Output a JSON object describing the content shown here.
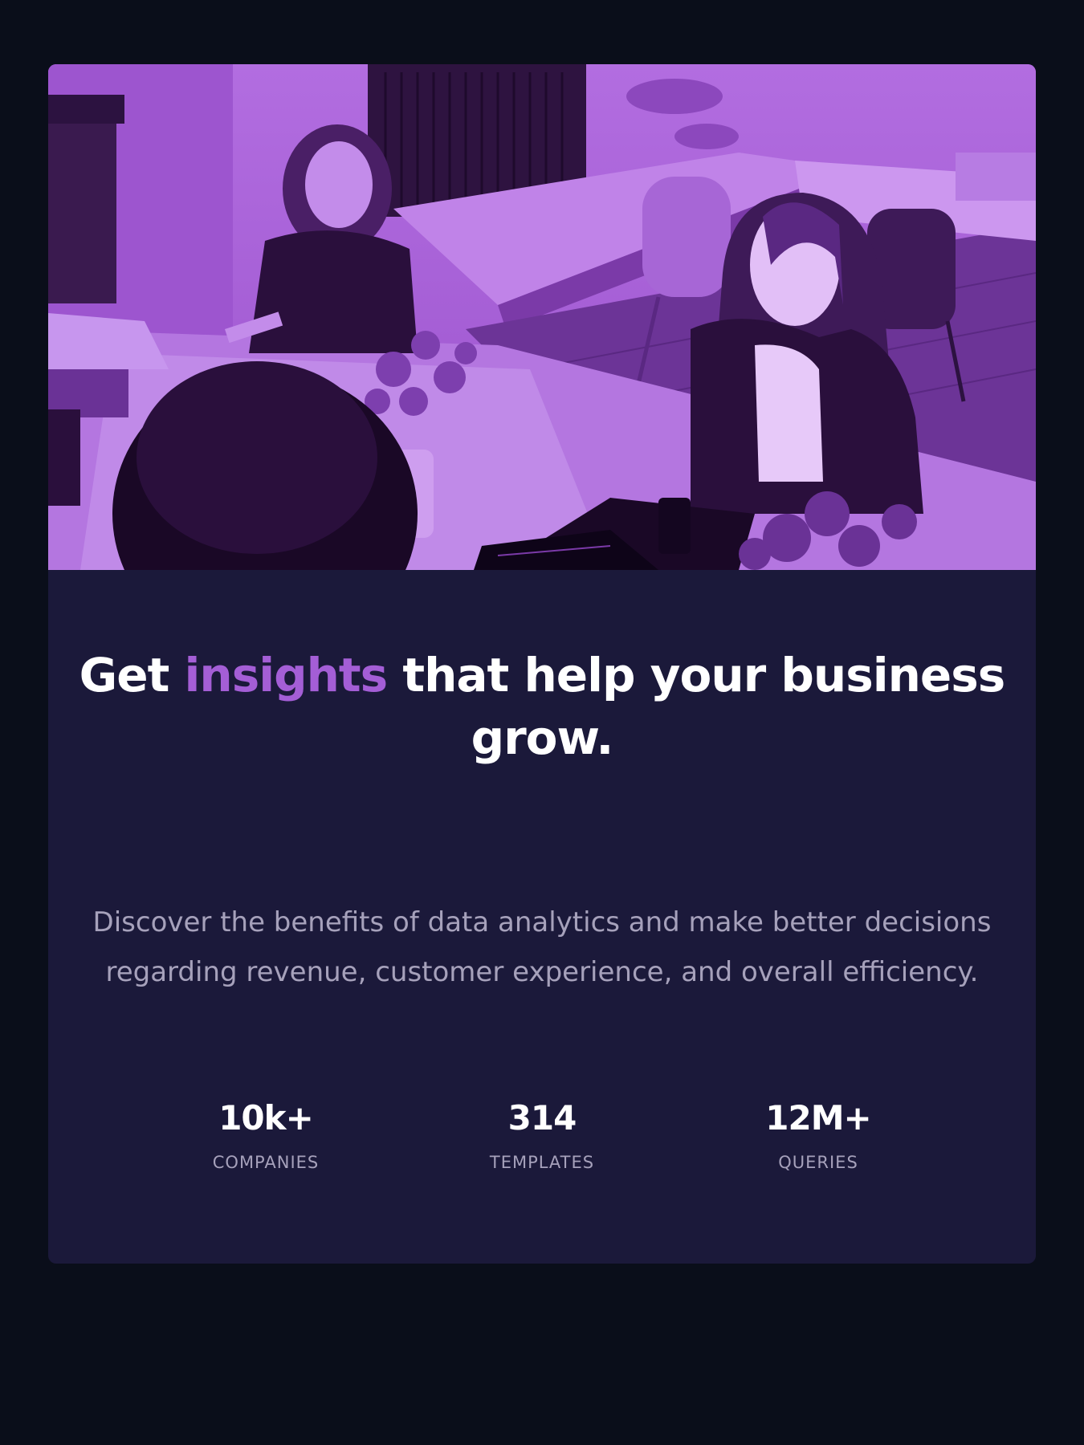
{
  "hero": {
    "alt": "Three women working together at a table in an office, with a purple overlay"
  },
  "headline": {
    "before": "Get ",
    "accent": "insights",
    "after": " that help your business grow."
  },
  "description": "Discover the benefits of data analytics and make better decisions regarding revenue, customer experience, and overall efficiency.",
  "stats": [
    {
      "value": "10k+",
      "label": "Companies"
    },
    {
      "value": "314",
      "label": "Templates"
    },
    {
      "value": "12M+",
      "label": "Queries"
    }
  ],
  "colors": {
    "page_background": "#0a0e1a",
    "card_background": "#1b193a",
    "accent": "#a45ed6",
    "heading": "#ffffff",
    "muted_text": "#a6a1bb"
  }
}
